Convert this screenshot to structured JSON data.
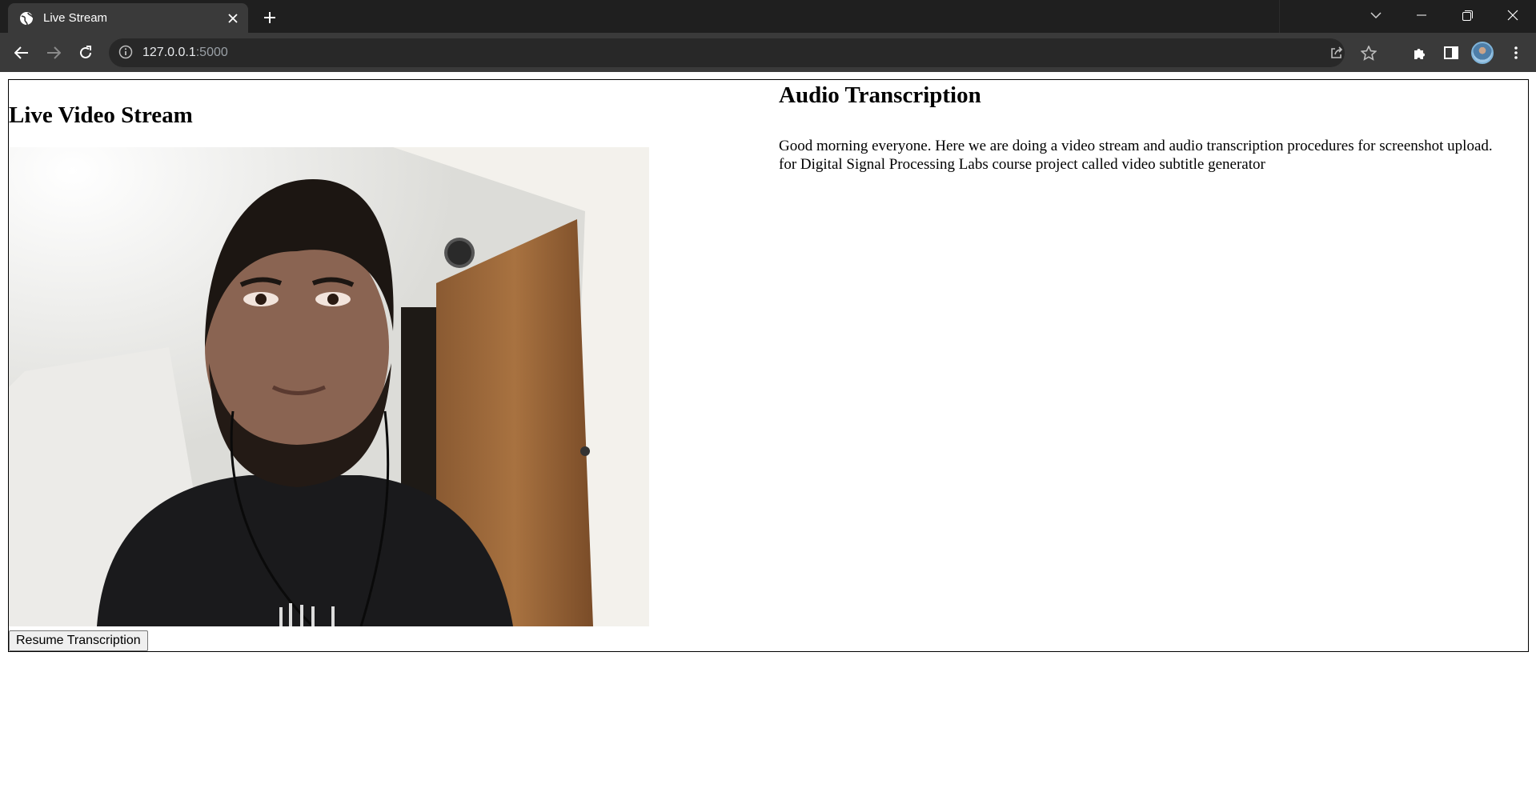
{
  "browser": {
    "tab_title": "Live Stream",
    "url_host": "127.0.0.1",
    "url_port": ":5000"
  },
  "icons": {
    "favicon": "globe-icon",
    "tab_close": "close-icon",
    "new_tab": "plus-icon",
    "tab_search": "chevron-down-icon",
    "minimize": "minimize-icon",
    "restore": "restore-icon",
    "close_window": "close-icon",
    "back": "arrow-left-icon",
    "forward": "arrow-right-icon",
    "reload": "reload-icon",
    "site_info": "info-icon",
    "share": "share-icon",
    "bookmark": "star-icon",
    "extensions": "puzzle-icon",
    "side_panel": "side-panel-icon",
    "menu": "kebab-menu-icon"
  },
  "colors": {
    "tabstrip_bg": "#1f1f1f",
    "toolbar_bg": "#3a3a3a",
    "omnibox_bg": "#282828",
    "page_bg": "#ffffff"
  },
  "page": {
    "video_heading": "Live Video Stream",
    "audio_heading": "Audio Transcription",
    "transcript_lines": [
      "Good morning everyone. Here we are doing a video stream and audio transcription procedures for screenshot upload.",
      "for Digital Signal Processing Labs course project called video subtitle generator"
    ],
    "resume_button": "Resume Transcription"
  }
}
